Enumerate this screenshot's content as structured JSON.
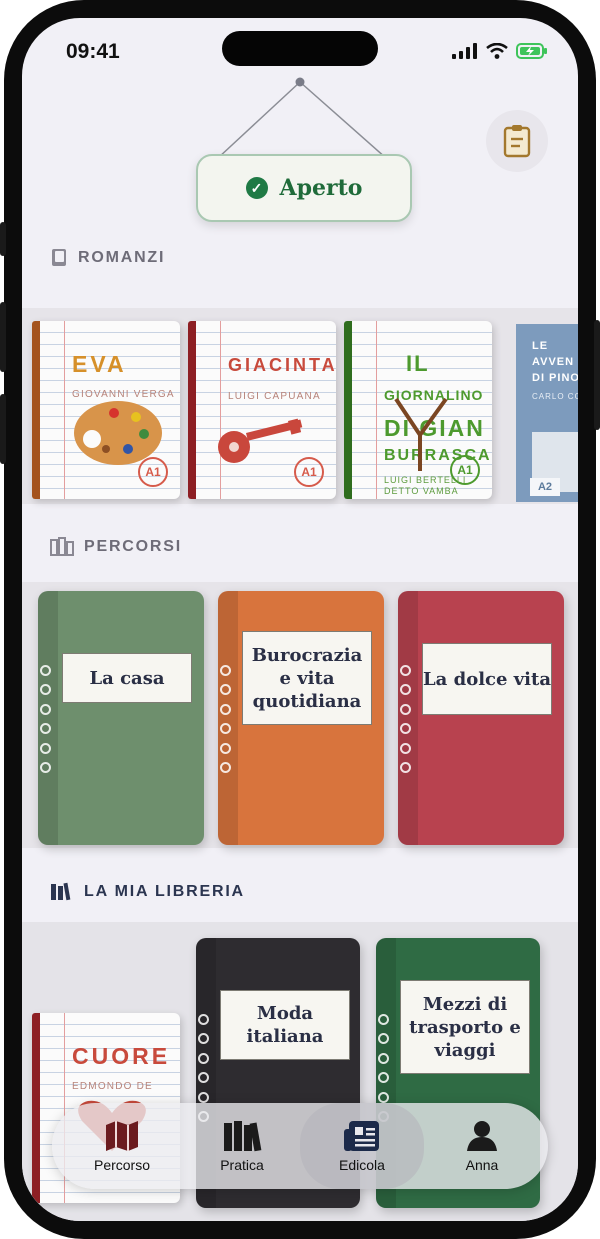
{
  "status": {
    "time": "09:41"
  },
  "sign": {
    "label": "Aperto"
  },
  "sections": {
    "romanzi": "ROMANZI",
    "percorsi": "PERCORSI",
    "libreria": "LA MIA LIBRERIA"
  },
  "romanzi": [
    {
      "title": "EVA",
      "author": "GIOVANNI VERGA",
      "level": "A1"
    },
    {
      "title": "GIACINTA",
      "author": "LUIGI CAPUANA",
      "level": "A1"
    },
    {
      "title_line1": "IL",
      "title_line2": "GIORNALINO",
      "title_line3": "DI GIAN",
      "title_line4": "BURRASCA",
      "author": "LUIGI BERTELLI DETTO VAMBA",
      "level": "A1"
    },
    {
      "title_line1": "LE",
      "title_line2": "AVVEN",
      "title_line3": "DI PINO",
      "author": "CARLO CO",
      "level": "A2"
    }
  ],
  "percorsi": [
    {
      "label": "La casa",
      "color": "#6e8f6d"
    },
    {
      "label": "Burocrazia e vita quotidiana",
      "color": "#d8743d"
    },
    {
      "label": "La dolce vita",
      "color": "#b8424f"
    }
  ],
  "libreria": [
    {
      "title": "CUORE",
      "author": "EDMONDO DE"
    },
    {
      "label": "Moda italiana",
      "color": "#2e2c30"
    },
    {
      "label": "Mezzi di trasporto e viaggi",
      "color": "#2f6b44"
    }
  ],
  "tabs": [
    {
      "label": "Percorso",
      "icon": "map-icon"
    },
    {
      "label": "Pratica",
      "icon": "books-icon"
    },
    {
      "label": "Edicola",
      "icon": "newspaper-icon"
    },
    {
      "label": "Anna",
      "icon": "person-icon"
    }
  ],
  "colors": {
    "accent_green": "#1f7a45",
    "background": "#f1f0f6",
    "header_gray": "#6e6c78"
  }
}
